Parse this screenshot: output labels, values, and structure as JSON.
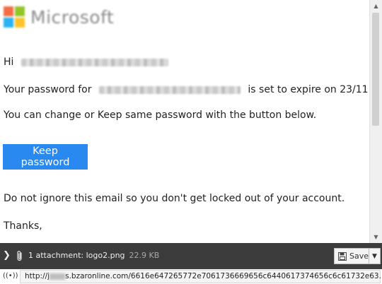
{
  "email": {
    "logo_text": "Microsoft",
    "greeting": "Hi",
    "password_prefix": "Your password for",
    "password_suffix": "is set to expire on 23/11.",
    "change_line": "You can change or Keep same password with the button below.",
    "button_label": "Keep password",
    "warning_line": "Do not ignore this email so you don't get locked out of your account.",
    "closing": "Thanks,"
  },
  "attachment": {
    "label": "1 attachment: logo2.png",
    "size": "22.9 KB",
    "save_label": "Save"
  },
  "status": {
    "url_prefix": "http://j",
    "url_suffix": "s.bzaronline.com/6616e647265772e7061736669656c6440617374656c6c61732e63..."
  },
  "colors": {
    "button": "#2a89f0",
    "attachment_bar": "#3c3c3c"
  }
}
